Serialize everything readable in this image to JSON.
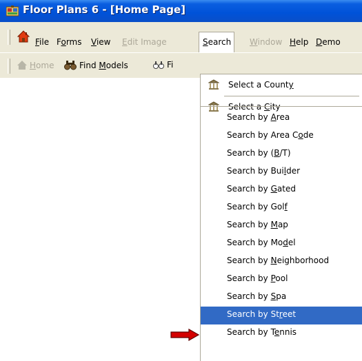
{
  "window": {
    "title": "Floor Plans 6 - [Home Page]"
  },
  "menubar": {
    "items": [
      {
        "label": "File",
        "state": "normal"
      },
      {
        "label": "Forms",
        "state": "normal"
      },
      {
        "label": "View",
        "state": "normal"
      },
      {
        "label": "Edit Image",
        "state": "disabled"
      },
      {
        "label": "Search",
        "state": "open"
      },
      {
        "label": "Window",
        "state": "disabled"
      },
      {
        "label": "Help",
        "state": "normal"
      },
      {
        "label": "Demo",
        "state": "normal"
      }
    ]
  },
  "toolbar": {
    "home_label": "Home",
    "find_models_label": "Find Models",
    "find_truncated_label": "Fi"
  },
  "search_menu": {
    "items": [
      {
        "label": "Select a County",
        "icon": "courthouse-icon"
      },
      {
        "label": "Select a City",
        "icon": "courthouse-icon"
      },
      {
        "label": "Search by Area"
      },
      {
        "label": "Search by Area Code"
      },
      {
        "label": "Search by (B/T)"
      },
      {
        "label": "Search by Builder"
      },
      {
        "label": "Search by Gated"
      },
      {
        "label": "Search by Golf"
      },
      {
        "label": "Search by Map"
      },
      {
        "label": "Search by Model"
      },
      {
        "label": "Search by Neighborhood"
      },
      {
        "label": "Search by Pool"
      },
      {
        "label": "Search by Spa"
      },
      {
        "label": "Search by Street",
        "highlighted": true
      },
      {
        "label": "Search by Tennis"
      }
    ]
  },
  "colors": {
    "titlebar": "#0052d8",
    "menu_face": "#ece9d8",
    "highlight": "#316ac5",
    "disabled_text": "#aca899",
    "arrow": "#d40000"
  }
}
